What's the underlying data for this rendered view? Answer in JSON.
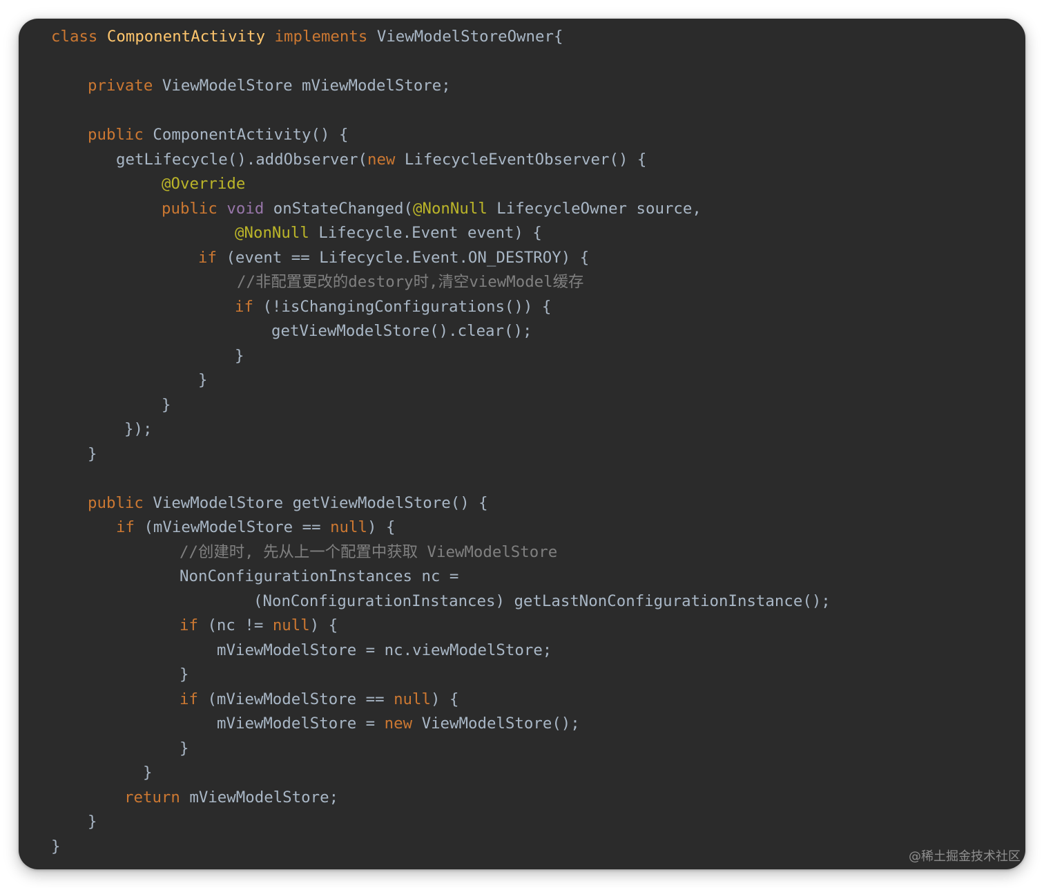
{
  "editor": {
    "theme_colors": {
      "background": "#2b2b2b",
      "text": "#a9b7c6",
      "keyword": "#cc7832",
      "class_name": "#ffc66d",
      "annotation": "#bbb529",
      "comment": "#808080",
      "void_keyword": "#9876aa"
    },
    "lines": [
      [
        [
          "kw",
          "class"
        ],
        [
          "pl",
          " "
        ],
        [
          "cls",
          "ComponentActivity"
        ],
        [
          "pl",
          " "
        ],
        [
          "kw",
          "implements"
        ],
        [
          "pl",
          " ViewModelStoreOwner{"
        ]
      ],
      [
        [
          "kw",
          "private"
        ],
        [
          "pl",
          " ViewModelStore mViewModelStore;"
        ]
      ],
      [
        [
          "kw",
          "public"
        ],
        [
          "pl",
          " ComponentActivity() {"
        ]
      ],
      [
        [
          "pl",
          "getLifecycle().addObserver("
        ],
        [
          "kw",
          "new"
        ],
        [
          "pl",
          " LifecycleEventObserver() {"
        ]
      ],
      [
        [
          "ann",
          "@Override"
        ]
      ],
      [
        [
          "kw",
          "public"
        ],
        [
          "pl",
          " "
        ],
        [
          "void",
          "void"
        ],
        [
          "pl",
          " onStateChanged("
        ],
        [
          "ann",
          "@NonNull"
        ],
        [
          "pl",
          " LifecycleOwner source,"
        ]
      ],
      [
        [
          "ann",
          "@NonNull"
        ],
        [
          "pl",
          " Lifecycle.Event event) {"
        ]
      ],
      [
        [
          "kw",
          "if"
        ],
        [
          "pl",
          " (event == Lifecycle.Event.ON_DESTROY) {"
        ]
      ],
      [
        [
          "cm",
          "//非配置更改的destory时,清空viewModel缓存"
        ]
      ],
      [
        [
          "kw",
          "if"
        ],
        [
          "pl",
          " (!isChangingConfigurations()) {"
        ]
      ],
      [
        [
          "pl",
          "getViewModelStore().clear();"
        ]
      ],
      [
        [
          "pl",
          "}"
        ]
      ],
      [
        [
          "pl",
          "}"
        ]
      ],
      [
        [
          "pl",
          "}"
        ]
      ],
      [
        [
          "pl",
          "});"
        ]
      ],
      [
        [
          "pl",
          "}"
        ]
      ],
      [
        [
          "kw",
          "public"
        ],
        [
          "pl",
          " ViewModelStore getViewModelStore() {"
        ]
      ],
      [
        [
          "kw",
          "if"
        ],
        [
          "pl",
          " (mViewModelStore == "
        ],
        [
          "kw",
          "null"
        ],
        [
          "pl",
          ") {"
        ]
      ],
      [
        [
          "cm",
          "//创建时, 先从上一个配置中获取 ViewModelStore"
        ]
      ],
      [
        [
          "pl",
          "NonConfigurationInstances nc ="
        ]
      ],
      [
        [
          "pl",
          "(NonConfigurationInstances) getLastNonConfigurationInstance();"
        ]
      ],
      [
        [
          "kw",
          "if"
        ],
        [
          "pl",
          " (nc != "
        ],
        [
          "kw",
          "null"
        ],
        [
          "pl",
          ") {"
        ]
      ],
      [
        [
          "pl",
          "mViewModelStore = nc.viewModelStore;"
        ]
      ],
      [
        [
          "pl",
          "}"
        ]
      ],
      [
        [
          "kw",
          "if"
        ],
        [
          "pl",
          " (mViewModelStore == "
        ],
        [
          "kw",
          "null"
        ],
        [
          "pl",
          ") {"
        ]
      ],
      [
        [
          "pl",
          "mViewModelStore = "
        ],
        [
          "kw",
          "new"
        ],
        [
          "pl",
          " ViewModelStore();"
        ]
      ],
      [
        [
          "pl",
          "}"
        ]
      ],
      [
        [
          "pl",
          "}"
        ]
      ],
      [
        [
          "kw",
          "return"
        ],
        [
          "pl",
          " mViewModelStore;"
        ]
      ],
      [
        [
          "pl",
          "}"
        ]
      ],
      [
        [
          "pl",
          "}"
        ]
      ]
    ]
  },
  "watermark": {
    "text": "@稀土掘金技术社区"
  }
}
